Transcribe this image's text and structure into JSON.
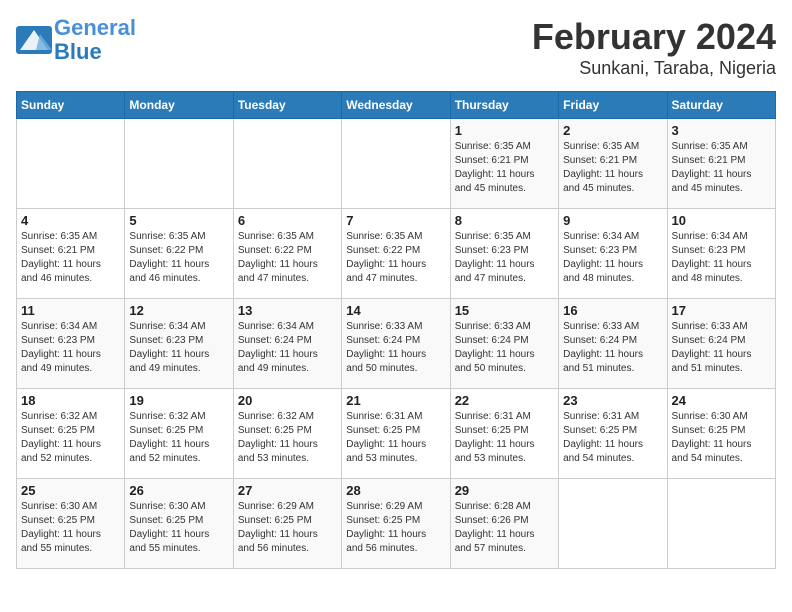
{
  "header": {
    "logo_line1": "General",
    "logo_line2": "Blue",
    "title": "February 2024",
    "subtitle": "Sunkani, Taraba, Nigeria"
  },
  "days_of_week": [
    "Sunday",
    "Monday",
    "Tuesday",
    "Wednesday",
    "Thursday",
    "Friday",
    "Saturday"
  ],
  "weeks": [
    [
      {
        "day": "",
        "info": ""
      },
      {
        "day": "",
        "info": ""
      },
      {
        "day": "",
        "info": ""
      },
      {
        "day": "",
        "info": ""
      },
      {
        "day": "1",
        "info": "Sunrise: 6:35 AM\nSunset: 6:21 PM\nDaylight: 11 hours\nand 45 minutes."
      },
      {
        "day": "2",
        "info": "Sunrise: 6:35 AM\nSunset: 6:21 PM\nDaylight: 11 hours\nand 45 minutes."
      },
      {
        "day": "3",
        "info": "Sunrise: 6:35 AM\nSunset: 6:21 PM\nDaylight: 11 hours\nand 45 minutes."
      }
    ],
    [
      {
        "day": "4",
        "info": "Sunrise: 6:35 AM\nSunset: 6:21 PM\nDaylight: 11 hours\nand 46 minutes."
      },
      {
        "day": "5",
        "info": "Sunrise: 6:35 AM\nSunset: 6:22 PM\nDaylight: 11 hours\nand 46 minutes."
      },
      {
        "day": "6",
        "info": "Sunrise: 6:35 AM\nSunset: 6:22 PM\nDaylight: 11 hours\nand 47 minutes."
      },
      {
        "day": "7",
        "info": "Sunrise: 6:35 AM\nSunset: 6:22 PM\nDaylight: 11 hours\nand 47 minutes."
      },
      {
        "day": "8",
        "info": "Sunrise: 6:35 AM\nSunset: 6:23 PM\nDaylight: 11 hours\nand 47 minutes."
      },
      {
        "day": "9",
        "info": "Sunrise: 6:34 AM\nSunset: 6:23 PM\nDaylight: 11 hours\nand 48 minutes."
      },
      {
        "day": "10",
        "info": "Sunrise: 6:34 AM\nSunset: 6:23 PM\nDaylight: 11 hours\nand 48 minutes."
      }
    ],
    [
      {
        "day": "11",
        "info": "Sunrise: 6:34 AM\nSunset: 6:23 PM\nDaylight: 11 hours\nand 49 minutes."
      },
      {
        "day": "12",
        "info": "Sunrise: 6:34 AM\nSunset: 6:23 PM\nDaylight: 11 hours\nand 49 minutes."
      },
      {
        "day": "13",
        "info": "Sunrise: 6:34 AM\nSunset: 6:24 PM\nDaylight: 11 hours\nand 49 minutes."
      },
      {
        "day": "14",
        "info": "Sunrise: 6:33 AM\nSunset: 6:24 PM\nDaylight: 11 hours\nand 50 minutes."
      },
      {
        "day": "15",
        "info": "Sunrise: 6:33 AM\nSunset: 6:24 PM\nDaylight: 11 hours\nand 50 minutes."
      },
      {
        "day": "16",
        "info": "Sunrise: 6:33 AM\nSunset: 6:24 PM\nDaylight: 11 hours\nand 51 minutes."
      },
      {
        "day": "17",
        "info": "Sunrise: 6:33 AM\nSunset: 6:24 PM\nDaylight: 11 hours\nand 51 minutes."
      }
    ],
    [
      {
        "day": "18",
        "info": "Sunrise: 6:32 AM\nSunset: 6:25 PM\nDaylight: 11 hours\nand 52 minutes."
      },
      {
        "day": "19",
        "info": "Sunrise: 6:32 AM\nSunset: 6:25 PM\nDaylight: 11 hours\nand 52 minutes."
      },
      {
        "day": "20",
        "info": "Sunrise: 6:32 AM\nSunset: 6:25 PM\nDaylight: 11 hours\nand 53 minutes."
      },
      {
        "day": "21",
        "info": "Sunrise: 6:31 AM\nSunset: 6:25 PM\nDaylight: 11 hours\nand 53 minutes."
      },
      {
        "day": "22",
        "info": "Sunrise: 6:31 AM\nSunset: 6:25 PM\nDaylight: 11 hours\nand 53 minutes."
      },
      {
        "day": "23",
        "info": "Sunrise: 6:31 AM\nSunset: 6:25 PM\nDaylight: 11 hours\nand 54 minutes."
      },
      {
        "day": "24",
        "info": "Sunrise: 6:30 AM\nSunset: 6:25 PM\nDaylight: 11 hours\nand 54 minutes."
      }
    ],
    [
      {
        "day": "25",
        "info": "Sunrise: 6:30 AM\nSunset: 6:25 PM\nDaylight: 11 hours\nand 55 minutes."
      },
      {
        "day": "26",
        "info": "Sunrise: 6:30 AM\nSunset: 6:25 PM\nDaylight: 11 hours\nand 55 minutes."
      },
      {
        "day": "27",
        "info": "Sunrise: 6:29 AM\nSunset: 6:25 PM\nDaylight: 11 hours\nand 56 minutes."
      },
      {
        "day": "28",
        "info": "Sunrise: 6:29 AM\nSunset: 6:25 PM\nDaylight: 11 hours\nand 56 minutes."
      },
      {
        "day": "29",
        "info": "Sunrise: 6:28 AM\nSunset: 6:26 PM\nDaylight: 11 hours\nand 57 minutes."
      },
      {
        "day": "",
        "info": ""
      },
      {
        "day": "",
        "info": ""
      }
    ]
  ]
}
